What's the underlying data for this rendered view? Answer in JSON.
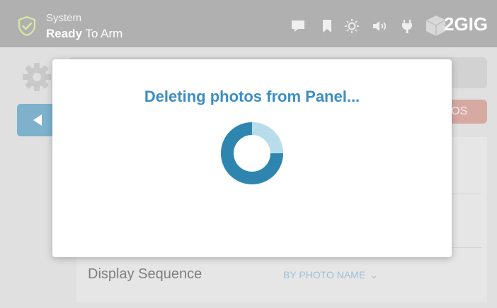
{
  "header": {
    "status_line1": "System",
    "status_line2_bold": "Ready",
    "status_line2_rest": " To Arm",
    "brand": "2GIG",
    "icons": [
      "shield-check-icon",
      "message-icon",
      "bookmark-icon",
      "brightness-icon",
      "volume-icon",
      "plug-icon",
      "2gig-logo-icon"
    ]
  },
  "background": {
    "red_button_label": "TOS",
    "display_label": "Display Sequence",
    "display_value": "BY PHOTO NAME"
  },
  "modal": {
    "title": "Deleting photos from Panel..."
  },
  "colors": {
    "header_bg": "#b0b0b0",
    "accent_blue": "#3b8ec3",
    "spinner_dark": "#2e86b0",
    "spinner_light": "#9fcde0"
  }
}
